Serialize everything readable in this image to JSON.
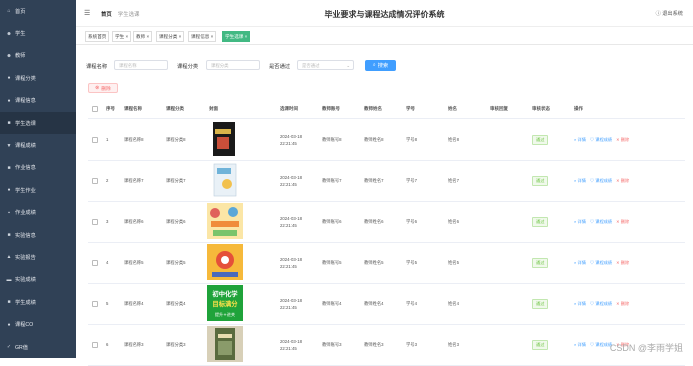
{
  "topbar": {
    "menu_glyph": "☰",
    "home": "首页",
    "crumb": "学生选课",
    "title": "毕业要求与课程达成情况评价系统",
    "logout": "退出系统"
  },
  "sidebar": {
    "items": [
      {
        "label": "首页",
        "icon": "home-icon",
        "glyph": "⌂"
      },
      {
        "label": "学生",
        "icon": "user-icon",
        "glyph": "☻"
      },
      {
        "label": "教师",
        "icon": "teacher-icon",
        "glyph": "☻"
      },
      {
        "label": "课程分类",
        "icon": "category-icon",
        "glyph": "●"
      },
      {
        "label": "课程信息",
        "icon": "info-icon",
        "glyph": "●"
      },
      {
        "label": "学生选课",
        "icon": "select-icon",
        "glyph": "■"
      },
      {
        "label": "课程成绩",
        "icon": "grade-icon",
        "glyph": "▼"
      },
      {
        "label": "作业信息",
        "icon": "homework-icon",
        "glyph": "■"
      },
      {
        "label": "学生作业",
        "icon": "student-homework-icon",
        "glyph": "●"
      },
      {
        "label": "作业成绩",
        "icon": "homework-grade-icon",
        "glyph": "▪"
      },
      {
        "label": "实验信息",
        "icon": "lab-icon",
        "glyph": "■"
      },
      {
        "label": "实验报告",
        "icon": "report-icon",
        "glyph": "▲"
      },
      {
        "label": "实验成绩",
        "icon": "lab-grade-icon",
        "glyph": "▬"
      },
      {
        "label": "学生成绩",
        "icon": "score-icon",
        "glyph": "■"
      },
      {
        "label": "课程CO",
        "icon": "co-icon",
        "glyph": "●"
      },
      {
        "label": "GR值",
        "icon": "gr-icon",
        "glyph": "✓"
      }
    ]
  },
  "tabs": [
    {
      "label": "系统首页"
    },
    {
      "label": "学生 ×"
    },
    {
      "label": "教师 ×"
    },
    {
      "label": "课程分类 ×"
    },
    {
      "label": "课程信息 ×"
    },
    {
      "label": "学生选课 ×",
      "active": true
    }
  ],
  "search": {
    "course_name_label": "课程名称",
    "course_name_placeholder": "课程名称",
    "category_label": "课程分类",
    "category_placeholder": "课程分类",
    "passed_label": "是否通过",
    "passed_placeholder": "是否通过",
    "search_button": "搜索",
    "delete_button": "删除"
  },
  "table": {
    "headers": [
      "序号",
      "课程名称",
      "课程分类",
      "封面",
      "选课时间",
      "教师账号",
      "教师姓名",
      "学号",
      "姓名",
      "审核回复",
      "审核状态",
      "操作"
    ],
    "rows": [
      {
        "no": "1",
        "name": "课程名称8",
        "category": "课程分类8",
        "time": "2024-03-18 22:21:45",
        "teacher_id": "教师账号8",
        "teacher_name": "教师姓名8",
        "student_id": "学号8",
        "student_name": "姓名8",
        "status": "通过"
      },
      {
        "no": "2",
        "name": "课程名称7",
        "category": "课程分类7",
        "time": "2024-03-18 22:21:45",
        "teacher_id": "教师账号7",
        "teacher_name": "教师姓名7",
        "student_id": "学号7",
        "student_name": "姓名7",
        "status": "通过"
      },
      {
        "no": "3",
        "name": "课程名称6",
        "category": "课程分类6",
        "time": "2024-03-18 22:21:45",
        "teacher_id": "教师账号6",
        "teacher_name": "教师姓名6",
        "student_id": "学号6",
        "student_name": "姓名6",
        "status": "通过"
      },
      {
        "no": "4",
        "name": "课程名称5",
        "category": "课程分类5",
        "time": "2024-03-18 22:21:45",
        "teacher_id": "教师账号5",
        "teacher_name": "教师姓名5",
        "student_id": "学号5",
        "student_name": "姓名5",
        "status": "通过"
      },
      {
        "no": "5",
        "name": "课程名称4",
        "category": "课程分类4",
        "time": "2024-03-18 22:21:45",
        "teacher_id": "教师账号4",
        "teacher_name": "教师姓名4",
        "student_id": "学号4",
        "student_name": "姓名4",
        "status": "通过"
      },
      {
        "no": "6",
        "name": "课程名称3",
        "category": "课程分类3",
        "time": "2024-03-18 22:21:45",
        "teacher_id": "教师账号3",
        "teacher_name": "教师姓名3",
        "student_id": "学号3",
        "student_name": "姓名3",
        "status": "通过"
      }
    ],
    "actions": {
      "detail": "详情",
      "grade": "课程成绩",
      "delete": "删除"
    },
    "cover5_lines": [
      "初中化学",
      "目标满分",
      "提升+进关"
    ]
  },
  "colors": {
    "sidebar": "#304156",
    "accent": "#409eff",
    "success": "#67c23a",
    "danger": "#f56c6c",
    "tab_active": "#42b983"
  },
  "watermark": "CSDN @李雨学姐"
}
